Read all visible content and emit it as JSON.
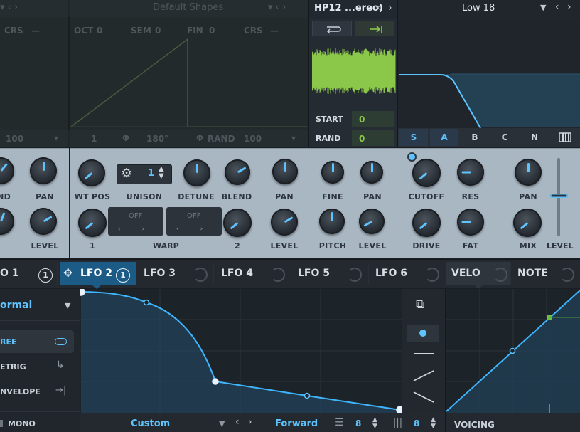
{
  "osc": {
    "shape_title": "Default Shapes",
    "params": [
      "CRS",
      "—",
      "OCT",
      "0",
      "SEM",
      "0",
      "FIN",
      "0",
      "CRS",
      "—"
    ],
    "bottom": {
      "v1": "100",
      "v2": "1",
      "v3": "180°",
      "rand": "RAND",
      "v4": "100"
    }
  },
  "noise": {
    "title": "HP12 ...ereo)",
    "start_label": "START",
    "start_value": "0",
    "rand_label": "RAND",
    "rand_value": "0"
  },
  "filter": {
    "title": "Low 18",
    "buttons": [
      "S",
      "A",
      "B",
      "C",
      "N"
    ]
  },
  "knobs": {
    "pan_a": "PAN",
    "nd": "ND",
    "level_a": "LEVEL",
    "wt_pos": "WT POS",
    "unison": "UNISON",
    "unison_value": "1",
    "detune": "DETUNE",
    "blend": "BLEND",
    "pan_b": "PAN",
    "warp_off_1": "OFF",
    "warp_off_2": "OFF",
    "warp_1": "1",
    "warp": "WARP",
    "warp_2": "2",
    "level_b": "LEVEL",
    "fine": "FINE",
    "pan_c": "PAN",
    "pitch": "PITCH",
    "level_c": "LEVEL",
    "cutoff": "CUTOFF",
    "res": "RES",
    "pan_d": "PAN",
    "drive": "DRIVE",
    "fat": "FAT",
    "mix": "MIX",
    "level_d": "LEVEL"
  },
  "tabs": {
    "lfo1": "O 1",
    "lfo1_count": "1",
    "lfo2": "LFO 2",
    "lfo2_count": "1",
    "lfo3": "LFO 3",
    "lfo4": "LFO 4",
    "lfo5": "LFO 5",
    "lfo6": "LFO 6",
    "velo": "VELO",
    "note": "NOTE"
  },
  "lfo": {
    "mode": "ormal",
    "options": [
      {
        "label": "REE"
      },
      {
        "label": "ETRIG"
      },
      {
        "label": "NVELOPE"
      }
    ],
    "mono": "MONO",
    "preset": "Custom",
    "direction": "Forward",
    "grid_value": "8",
    "steps_value": "8"
  },
  "velo": {
    "voicing": "VOICING"
  },
  "colors": {
    "accent": "#5ec4ff",
    "panel": "#a9b7c3",
    "waveform": "#8bc84a",
    "bg": "#1b1f24"
  }
}
